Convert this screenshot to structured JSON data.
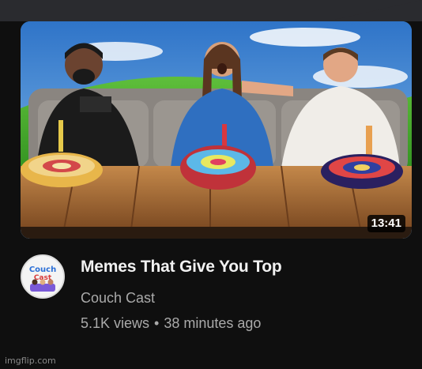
{
  "video": {
    "duration": "13:41",
    "title": "Memes That Give You Top",
    "channel": "Couch Cast",
    "views": "5.1K views",
    "separator": "•",
    "age": "38 minutes ago"
  },
  "avatar": {
    "logo_text": "Couch Cast"
  },
  "watermark": "imgflip.com",
  "colors": {
    "background": "#0f0f0f",
    "title": "#f1f1f1",
    "secondary_text": "#aaaaaa",
    "bubble": "#2a2b2f"
  },
  "icons": {
    "avatar": "channel-avatar-icon"
  }
}
